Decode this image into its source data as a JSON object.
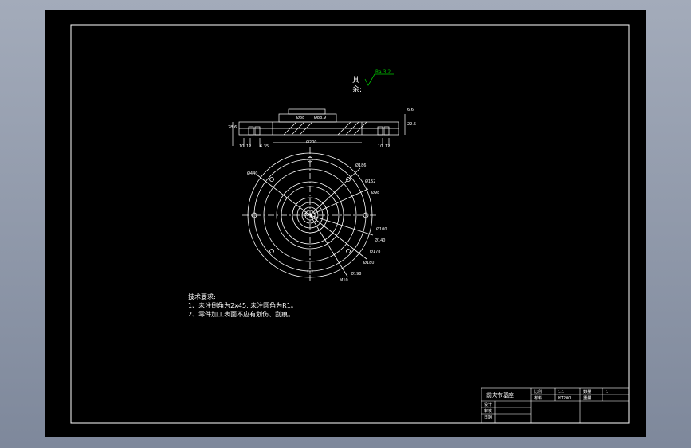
{
  "window": {
    "title": ""
  },
  "drawing": {
    "surface_finish": {
      "label_line1": "其",
      "label_line2": "余:",
      "value": "Ra 3.2"
    },
    "section_view": {
      "dim_top": "Ø88",
      "dim_top2": "Ø88.9",
      "dim_bottom": "Ø200",
      "dim_left": "28.6",
      "dim_left2": "10",
      "dim_left3": "12",
      "dim_right": "22.5",
      "dim_right2": "10",
      "dim_right3": "12",
      "dim_mid": "6.35",
      "dim_top_right": "6.6"
    },
    "plan_view": {
      "dim_labels": [
        "Ø440",
        "Ø186",
        "Ø152",
        "Ø98",
        "Ø35",
        "Ø100",
        "Ø140",
        "Ø178",
        "Ø180",
        "Ø198",
        "M10"
      ]
    },
    "notes": {
      "heading": "技术要求:",
      "line1": "1、未注倒角为2x45, 未注圆角为R1。",
      "line2": "2、零件加工表面不应有划伤、刮痕。"
    }
  },
  "title_block": {
    "part_name": "前夹节基座",
    "cells": [
      "比例",
      "1:1",
      "数量",
      "1",
      "材料",
      "HT200",
      "重量",
      "",
      "设计",
      "",
      "审核",
      "",
      "日期",
      ""
    ]
  },
  "colors": {
    "background": "#000000",
    "line": "#ffffff",
    "accent": "#00c800",
    "frame": "#8a94a6"
  }
}
